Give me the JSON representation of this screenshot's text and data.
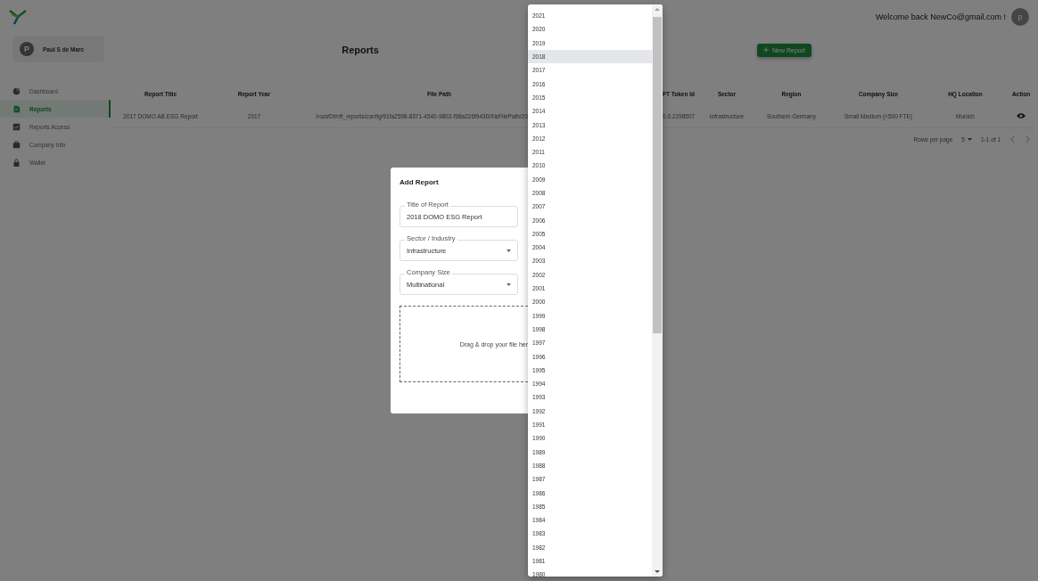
{
  "header": {
    "welcome": "Welcome back NewCo@gmail.com !",
    "avatar_initial": "p"
  },
  "sidebar": {
    "profile": {
      "initial": "P",
      "name": "Paul S de Marc"
    },
    "items": [
      {
        "label": "Dashboard",
        "selected": false
      },
      {
        "label": "Reports",
        "selected": true
      },
      {
        "label": "Reports Access",
        "selected": false
      },
      {
        "label": "Company Info",
        "selected": false
      },
      {
        "label": "Wallet",
        "selected": false
      }
    ]
  },
  "page": {
    "title": "Reports",
    "new_button": "New Report"
  },
  "table": {
    "columns": [
      "Report Title",
      "Report Year",
      "File Path",
      "FT Token Id",
      "Sector",
      "Region",
      "Company Size",
      "HQ Location",
      "Action"
    ],
    "rows": [
      {
        "cells": [
          "2017 DOMO AB ESG Report",
          "2017",
          "/root/Dt/nft_reports/config/91fa2598-8371-4540-9802-f98a226f9430/XlsFilePath/20",
          "0.0.2298507",
          "Infrastructure",
          "Southern Germany",
          "Small Medium (<500 FTE)",
          "Munich"
        ]
      }
    ],
    "pagination": {
      "rows_per_page_label": "Rows per page",
      "rows_per_page": "5",
      "range": "1-1 of 1"
    }
  },
  "modal": {
    "title": "Add Report",
    "fields": [
      {
        "kind": "text",
        "label": "Title of Report",
        "value": "2018 DOMO ESG Report"
      },
      {
        "kind": "select",
        "label": "Sector / Industry",
        "value": "Infrastructure"
      },
      {
        "kind": "select",
        "label": "Company Size",
        "value": "Multinational"
      }
    ],
    "dropzone": "Drag & drop your file her"
  },
  "year_dropdown": {
    "options": [
      {
        "label": "2021",
        "selected": false
      },
      {
        "label": "2020",
        "selected": false
      },
      {
        "label": "2019",
        "selected": false
      },
      {
        "label": "2018",
        "selected": true
      },
      {
        "label": "2017",
        "selected": false
      },
      {
        "label": "2016",
        "selected": false
      },
      {
        "label": "2015",
        "selected": false
      },
      {
        "label": "2014",
        "selected": false
      },
      {
        "label": "2013",
        "selected": false
      },
      {
        "label": "2012",
        "selected": false
      },
      {
        "label": "2011",
        "selected": false
      },
      {
        "label": "2010",
        "selected": false
      },
      {
        "label": "2009",
        "selected": false
      },
      {
        "label": "2008",
        "selected": false
      },
      {
        "label": "2007",
        "selected": false
      },
      {
        "label": "2006",
        "selected": false
      },
      {
        "label": "2005",
        "selected": false
      },
      {
        "label": "2004",
        "selected": false
      },
      {
        "label": "2003",
        "selected": false
      },
      {
        "label": "2002",
        "selected": false
      },
      {
        "label": "2001",
        "selected": false
      },
      {
        "label": "2000",
        "selected": false
      },
      {
        "label": "1999",
        "selected": false
      },
      {
        "label": "1998",
        "selected": false
      },
      {
        "label": "1997",
        "selected": false
      },
      {
        "label": "1996",
        "selected": false
      },
      {
        "label": "1995",
        "selected": false
      },
      {
        "label": "1994",
        "selected": false
      },
      {
        "label": "1993",
        "selected": false
      },
      {
        "label": "1992",
        "selected": false
      },
      {
        "label": "1991",
        "selected": false
      },
      {
        "label": "1990",
        "selected": false
      },
      {
        "label": "1989",
        "selected": false
      },
      {
        "label": "1988",
        "selected": false
      },
      {
        "label": "1987",
        "selected": false
      },
      {
        "label": "1986",
        "selected": false
      },
      {
        "label": "1985",
        "selected": false
      },
      {
        "label": "1984",
        "selected": false
      },
      {
        "label": "1983",
        "selected": false
      },
      {
        "label": "1982",
        "selected": false
      },
      {
        "label": "1981",
        "selected": false
      },
      {
        "label": "1980",
        "selected": false
      }
    ]
  }
}
